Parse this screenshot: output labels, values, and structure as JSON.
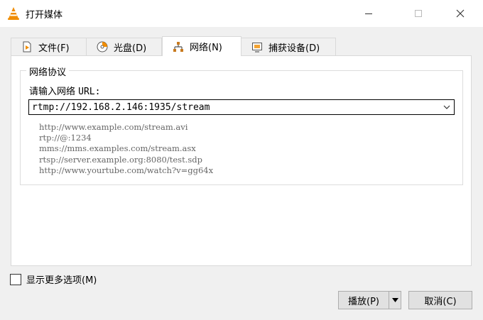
{
  "window": {
    "title": "打开媒体"
  },
  "tabs": [
    {
      "label": "文件(F)",
      "icon": "file-play-icon"
    },
    {
      "label": "光盘(D)",
      "icon": "disc-icon"
    },
    {
      "label": "网络(N)",
      "icon": "network-icon",
      "active": true
    },
    {
      "label": "捕获设备(D)",
      "icon": "capture-device-icon"
    }
  ],
  "network": {
    "group_title": "网络协议",
    "url_label_prefix": "请输入网络",
    "url_label_suffix": "URL:",
    "url_value": "rtmp://192.168.2.146:1935/stream",
    "examples": [
      "http://www.example.com/stream.avi",
      "rtp://@:1234",
      "mms://mms.examples.com/stream.asx",
      "rtsp://server.example.org:8080/test.sdp",
      "http://www.yourtube.com/watch?v=gg64x"
    ]
  },
  "options": {
    "show_more_label": "显示更多选项(M)",
    "checked": false
  },
  "buttons": {
    "play_label": "播放(P)",
    "cancel_label": "取消(C)"
  },
  "colors": {
    "accent_orange": "#f08c00",
    "network_icon": "#c87a1e"
  }
}
